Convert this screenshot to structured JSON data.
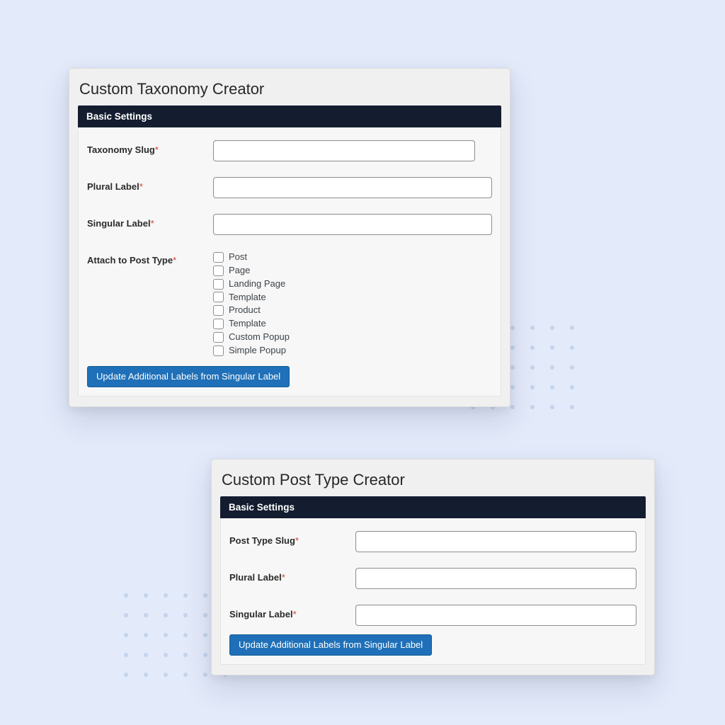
{
  "colors": {
    "page_bg": "#e3eafa",
    "card_bg": "#f0f0f1",
    "section_head_bg": "#141d2f",
    "button_bg": "#1f70b8",
    "required_asterisk": "#d33a2c"
  },
  "card1": {
    "title": "Custom Taxonomy Creator",
    "section_title": "Basic Settings",
    "fields": {
      "taxonomy_slug": {
        "label": "Taxonomy Slug",
        "value": ""
      },
      "plural_label": {
        "label": "Plural Label",
        "value": ""
      },
      "singular_label": {
        "label": "Singular Label",
        "value": ""
      },
      "attach_post_type": {
        "label": "Attach to Post Type",
        "options": [
          "Post",
          "Page",
          "Landing Page",
          "Template",
          "Product",
          "Template",
          "Custom Popup",
          "Simple Popup"
        ]
      }
    },
    "button": "Update Additional Labels from Singular Label"
  },
  "card2": {
    "title": "Custom Post Type Creator",
    "section_title": "Basic Settings",
    "fields": {
      "post_type_slug": {
        "label": "Post Type Slug",
        "value": ""
      },
      "plural_label": {
        "label": "Plural Label",
        "value": ""
      },
      "singular_label": {
        "label": "Singular Label",
        "value": ""
      }
    },
    "button": "Update Additional Labels from Singular Label"
  }
}
